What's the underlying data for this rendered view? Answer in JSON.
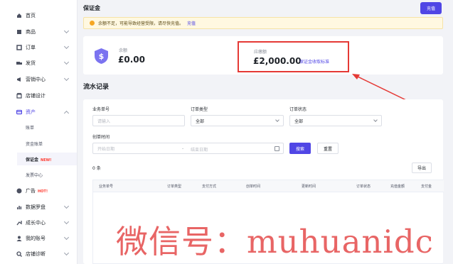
{
  "sidebar": {
    "items": [
      {
        "label": "首页",
        "has_arrow": false
      },
      {
        "label": "商品",
        "has_arrow": true
      },
      {
        "label": "订单",
        "has_arrow": true
      },
      {
        "label": "发货",
        "has_arrow": true
      },
      {
        "label": "营销中心",
        "has_arrow": true
      },
      {
        "label": "店铺设计",
        "has_arrow": false
      },
      {
        "label": "资产",
        "has_arrow": true,
        "expanded": true
      }
    ],
    "sub_items": [
      {
        "label": "账单"
      },
      {
        "label": "资金账单"
      },
      {
        "label": "保证金",
        "badge": "NEW!",
        "active": true
      },
      {
        "label": "发票中心"
      }
    ],
    "bottom_items": [
      {
        "label": "广告",
        "badge": "HOT!",
        "has_arrow": false
      },
      {
        "label": "数据罗盘",
        "has_arrow": true
      },
      {
        "label": "成长中心",
        "has_arrow": true
      },
      {
        "label": "我的账号",
        "has_arrow": true
      },
      {
        "label": "店铺诊断",
        "has_arrow": true
      }
    ]
  },
  "header": {
    "title": "保证金",
    "button_label": "充值"
  },
  "notice": {
    "text": "余额不足，可能导致经营受限，请尽快充值。",
    "link": "充值"
  },
  "balance": {
    "label": "余额",
    "value": "£0.00"
  },
  "quota": {
    "label": "应缴额",
    "value": "£2,000.00",
    "link": "保证金收取标准"
  },
  "records": {
    "title": "流水记录"
  },
  "filters": {
    "business_no": {
      "label": "业务单号",
      "placeholder": "请输入"
    },
    "order_type": {
      "label": "订单类型",
      "value": "全部"
    },
    "order_status": {
      "label": "订单状态",
      "value": "全部"
    },
    "created_time": {
      "label": "创单时间",
      "start_placeholder": "开始日期",
      "separator": "-",
      "end_placeholder": "结束日期"
    },
    "search_label": "搜索",
    "reset_label": "重置"
  },
  "count": "0 条",
  "export_label": "导出",
  "table": {
    "columns": [
      "业务单号",
      "订单类型",
      "支付方式",
      "创单时间",
      "更新时间",
      "订单状态",
      "充值金额",
      "支付金"
    ]
  },
  "watermark": "微信号：muhuanidc",
  "colors": {
    "accent": "#5046e5",
    "highlight": "#e53935",
    "notice_bg": "#fff8e1"
  }
}
